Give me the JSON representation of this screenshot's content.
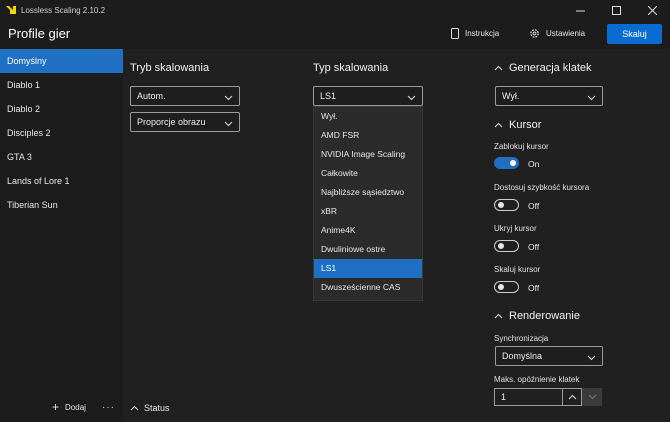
{
  "window": {
    "title": "Lossless Scaling 2.10.2",
    "logo_color": "#f5d800",
    "accent": "#1f6fc2",
    "button_accent": "#0a6cd1"
  },
  "header": {
    "title": "Profile gier",
    "instructions_label": "Instrukcja",
    "settings_label": "Ustawienia",
    "scale_label": "Skaluj"
  },
  "sidebar": {
    "items": [
      {
        "label": "Domyślny",
        "active": true
      },
      {
        "label": "Diablo 1"
      },
      {
        "label": "Diablo 2"
      },
      {
        "label": "Disciples 2"
      },
      {
        "label": "GTA 3"
      },
      {
        "label": "Lands of Lore 1"
      },
      {
        "label": "Tiberian Sun"
      }
    ],
    "add_label": "Dodaj",
    "more_label": "···"
  },
  "scaling_mode": {
    "title": "Tryb skalowania",
    "mode_value": "Autom.",
    "aspect_value": "Proporcje obrazu"
  },
  "scaling_type": {
    "title": "Typ skalowania",
    "value": "LS1",
    "options": [
      "Wył.",
      "AMD FSR",
      "NVIDIA Image Scaling",
      "Całkowite",
      "Najbliższe sąsiedztwo",
      "xBR",
      "Anime4K",
      "Dwuliniowe ostre",
      "LS1",
      "Dwusześcienne CAS"
    ],
    "selected_index": 8
  },
  "status": {
    "label": "Status"
  },
  "frame_gen": {
    "title": "Generacja klatek",
    "value": "Wył."
  },
  "cursor": {
    "title": "Kursor",
    "lock_label": "Zablokuj kursor",
    "lock_state": "On",
    "speed_label": "Dostosuj szybkość kursora",
    "speed_state": "Off",
    "hide_label": "Ukryj kursor",
    "hide_state": "Off",
    "scale_label": "Skaluj kursor",
    "scale_state": "Off"
  },
  "rendering": {
    "title": "Renderowanie",
    "sync_label": "Synchronizacja",
    "sync_value": "Domyślna",
    "max_delay_label": "Maks. opóźnienie klatek",
    "max_delay_value": "1"
  }
}
